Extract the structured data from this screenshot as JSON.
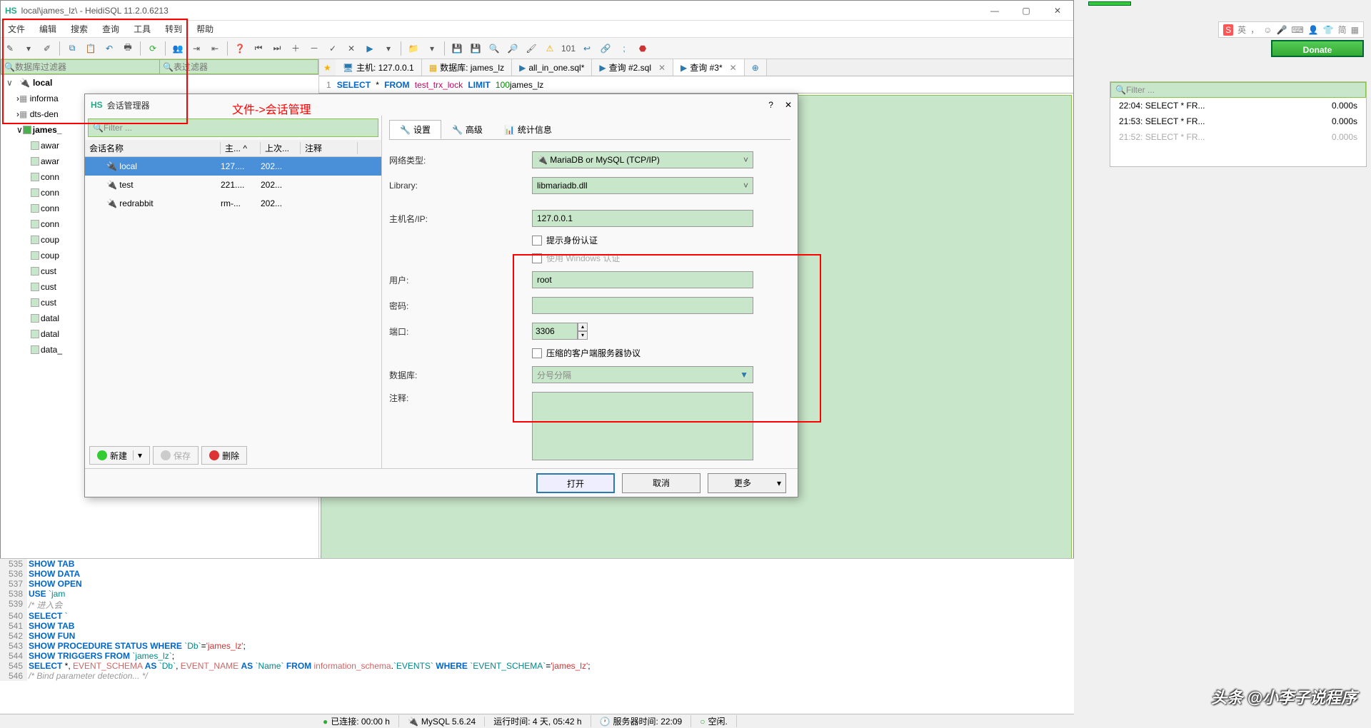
{
  "title": "local\\james_lz\\ - HeidiSQL 11.2.0.6213",
  "menu": {
    "items": [
      "文件",
      "编辑",
      "搜索",
      "查询",
      "工具",
      "转到",
      "帮助"
    ]
  },
  "filters": {
    "db": "数据库过滤器",
    "table": "表过滤器"
  },
  "tree": {
    "root": "local",
    "items": [
      "informa",
      "dts-den",
      "james_",
      "awar",
      "awar",
      "conn",
      "conn",
      "conn",
      "conn",
      "coup",
      "coup",
      "cust",
      "cust",
      "cust",
      "datal",
      "datal",
      "data_"
    ]
  },
  "tabs": {
    "host": "主机: 127.0.0.1",
    "db": "数据库: james_lz",
    "t3": "all_in_one.sql*",
    "t4": "查询 #2.sql",
    "t5": "查询 #3*"
  },
  "sql_line": {
    "ln": "1",
    "sel": "SELECT",
    "star": "*",
    "from": "FROM",
    "tbl": "test_trx_lock",
    "lim": "LIMIT",
    "num": "100",
    "rest": "james_lz"
  },
  "history": {
    "filter": "Filter ...",
    "rows": [
      {
        "t": "22:04: SELECT  * FR...",
        "d": "0.000s"
      },
      {
        "t": "21:53: SELECT  * FR...",
        "d": "0.000s"
      },
      {
        "t": "21:52: SELECT  * FR...",
        "d": "0.000s"
      }
    ]
  },
  "log": {
    "lines": [
      {
        "n": "535",
        "kw": "SHOW TAB"
      },
      {
        "n": "536",
        "kw": "SHOW DATA"
      },
      {
        "n": "537",
        "kw": "SHOW OPEN"
      },
      {
        "n": "538",
        "kw": "USE",
        "tn": " `jam"
      },
      {
        "n": "539",
        "cmt": "/* 进入会"
      },
      {
        "n": "540",
        "kw": "SELECT",
        "tn": " `"
      },
      {
        "n": "541",
        "kw": "SHOW TAB"
      },
      {
        "n": "542",
        "kw": "SHOW FUN"
      },
      {
        "n": "543",
        "full": "SHOW PROCEDURE STATUS WHERE `Db`='james_lz';"
      },
      {
        "n": "544",
        "full": "SHOW TRIGGERS FROM `james_lz`;"
      },
      {
        "n": "545",
        "full": "SELECT *, EVENT_SCHEMA AS `Db`, EVENT_NAME AS `Name` FROM information_schema.`EVENTS` WHERE `EVENT_SCHEMA`='james_lz';"
      },
      {
        "n": "546",
        "cmt": "/* Bind parameter detection... */"
      }
    ]
  },
  "status": {
    "conn": "已连接: 00:00 h",
    "server": "MySQL 5.6.24",
    "uptime": "运行时间: 4 天, 05:42 h",
    "servertime": "服务器时间: 22:09",
    "idle": "空闲."
  },
  "donate": "Donate",
  "ime": {
    "lang": "英",
    "kan": "简"
  },
  "dialog": {
    "title": "会话管理器",
    "filter": "Filter ...",
    "cols": {
      "name": "会话名称",
      "host": "主... ^",
      "last": "上次...",
      "note": "注释"
    },
    "rows": [
      {
        "name": "local",
        "host": "127....",
        "last": "202..."
      },
      {
        "name": "test",
        "host": "221....",
        "last": "202..."
      },
      {
        "name": "redrabbit",
        "host": "rm-...",
        "last": "202..."
      }
    ],
    "btns": {
      "new": "新建",
      "save": "保存",
      "del": "删除"
    },
    "tabs": {
      "set": "设置",
      "adv": "高级",
      "stat": "统计信息"
    },
    "form": {
      "net": "网络类型:",
      "net_v": "MariaDB or MySQL (TCP/IP)",
      "lib": "Library:",
      "lib_v": "libmariadb.dll",
      "host": "主机名/IP:",
      "host_v": "127.0.0.1",
      "cred": "提示身份认证",
      "winauth": "使用 Windows 认证",
      "user": "用户:",
      "user_v": "root",
      "pass": "密码:",
      "port": "端口:",
      "port_v": "3306",
      "compress": "压缩的客户端服务器协议",
      "dbs": "数据库:",
      "dbs_ph": "分号分隔",
      "note": "注释:"
    },
    "bot": {
      "open": "打开",
      "cancel": "取消",
      "more": "更多"
    }
  },
  "annot": "文件->会话管理",
  "watermark": "头条 @小李子说程序"
}
